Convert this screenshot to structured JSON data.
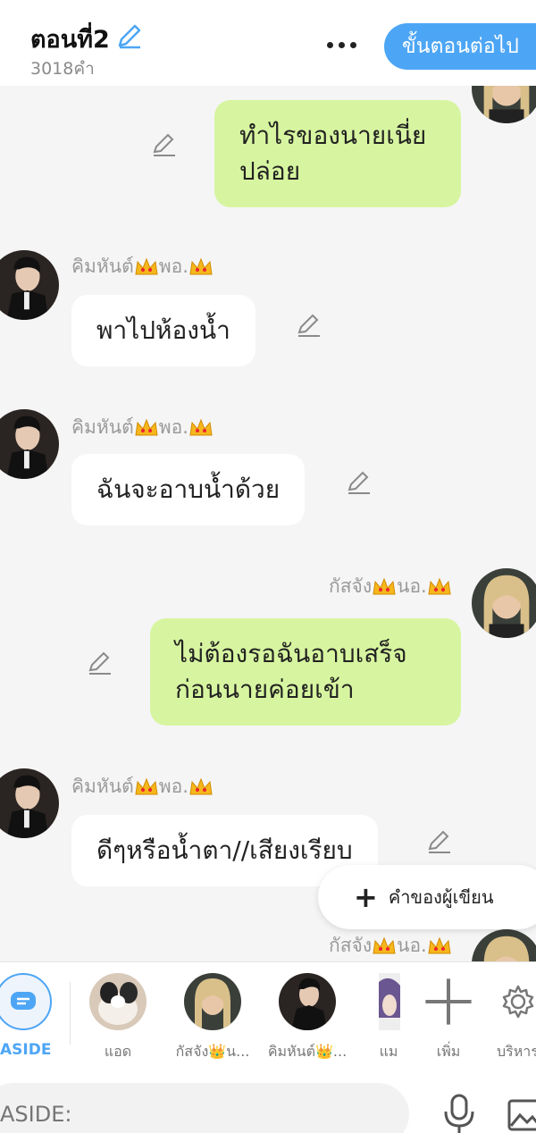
{
  "header": {
    "episode_title": "ตอนที่2",
    "word_count": "3018คำ",
    "next_label": "ขั้นตอนต่อไป"
  },
  "messages": [
    {
      "side": "right",
      "text_lines": [
        "ทำไรของนายเนี่ย",
        "ปล่อย"
      ]
    },
    {
      "side": "left",
      "sender": "คิมหันต์",
      "sender_suffix": "พอ.",
      "text": "พาไปห้องน้ำ"
    },
    {
      "side": "left",
      "sender": "คิมหันต์",
      "sender_suffix": "พอ.",
      "text": "ฉันจะอาบน้ำด้วย"
    },
    {
      "side": "right",
      "sender": "กัสจัง",
      "sender_suffix": "นอ.",
      "text_lines": [
        "ไม่ต้องรอฉันอาบเสร็จ",
        "ก่อนนายค่อยเข้า"
      ]
    },
    {
      "side": "left",
      "sender": "คิมหันต์",
      "sender_suffix": "พอ.",
      "text": "ดีๆหรือน้ำตา//เสียงเรียบ"
    },
    {
      "side": "right",
      "sender": "กัสจัง",
      "sender_suffix": "นอ."
    }
  ],
  "author_note": {
    "label": "คำของผู้เขียน"
  },
  "charbar": {
    "aside_label": "ASIDE",
    "characters": [
      {
        "label": "แอด"
      },
      {
        "label": "กัสจัง👑น..."
      },
      {
        "label": "คิมหันต์👑..."
      },
      {
        "label": "แม"
      }
    ],
    "add_label": "เพิ่ม",
    "manage_label": "บริหาร"
  },
  "input": {
    "placeholder": "ASIDE:"
  },
  "colors": {
    "accent": "#4da6f5",
    "green_bubble": "#d7f5a0",
    "white_bubble": "#ffffff",
    "background": "#f5f5f5"
  }
}
